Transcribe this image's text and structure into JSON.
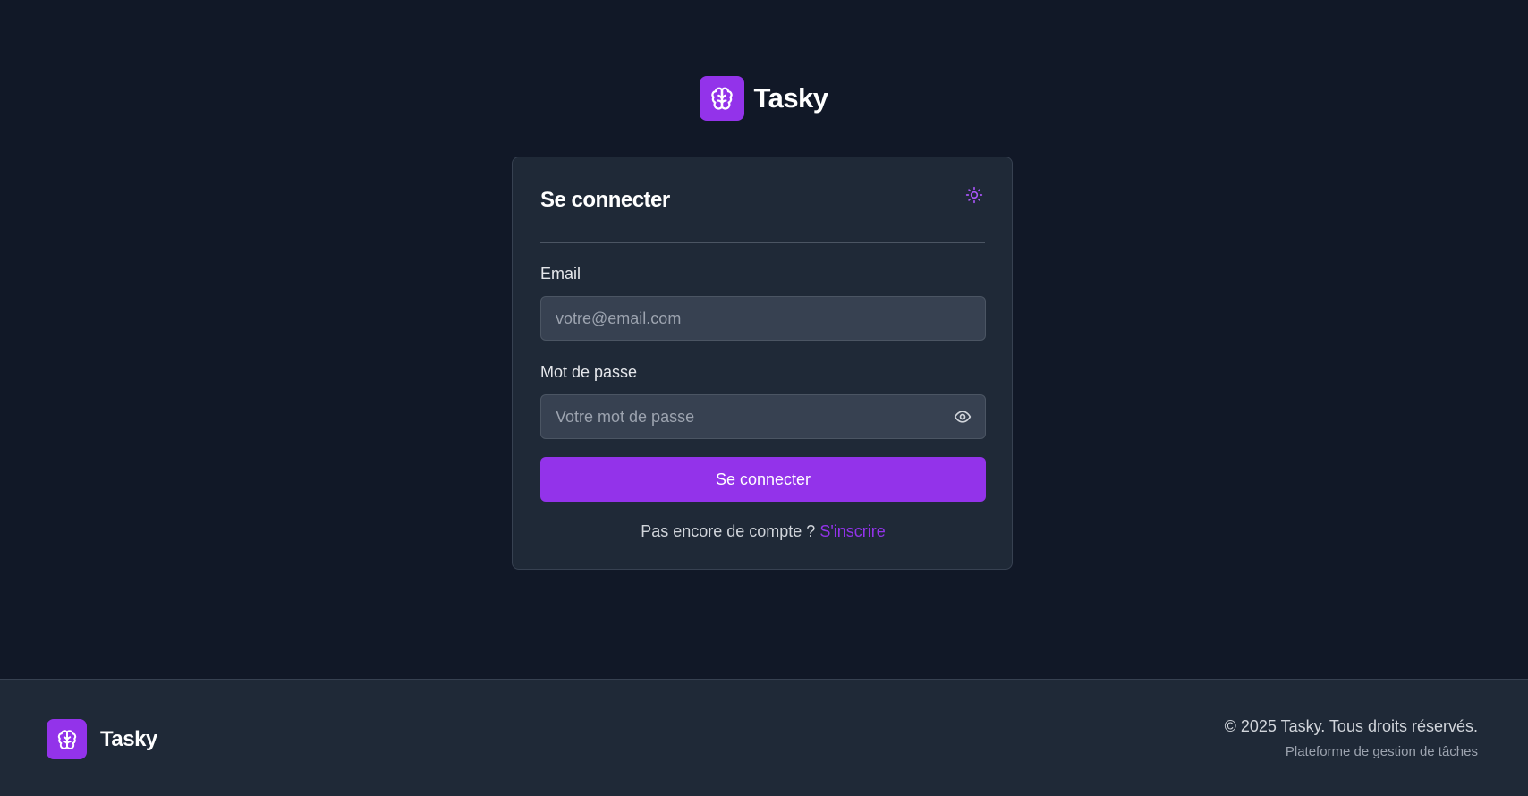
{
  "brand": {
    "name": "Tasky",
    "logo_icon": "brain-icon"
  },
  "login_card": {
    "title": "Se connecter",
    "theme_toggle_icon": "sun-icon",
    "email": {
      "label": "Email",
      "placeholder": "votre@email.com",
      "value": ""
    },
    "password": {
      "label": "Mot de passe",
      "placeholder": "Votre mot de passe",
      "value": "",
      "toggle_icon": "eye-icon"
    },
    "submit_label": "Se connecter",
    "signup_prompt": "Pas encore de compte ?",
    "signup_link": "S'inscrire"
  },
  "footer": {
    "brand_name": "Tasky",
    "copyright": "© 2025 Tasky. Tous droits réservés.",
    "tagline": "Plateforme de gestion de tâches"
  },
  "colors": {
    "background": "#111827",
    "card": "#1f2937",
    "accent": "#9333ea",
    "input": "#374151"
  }
}
